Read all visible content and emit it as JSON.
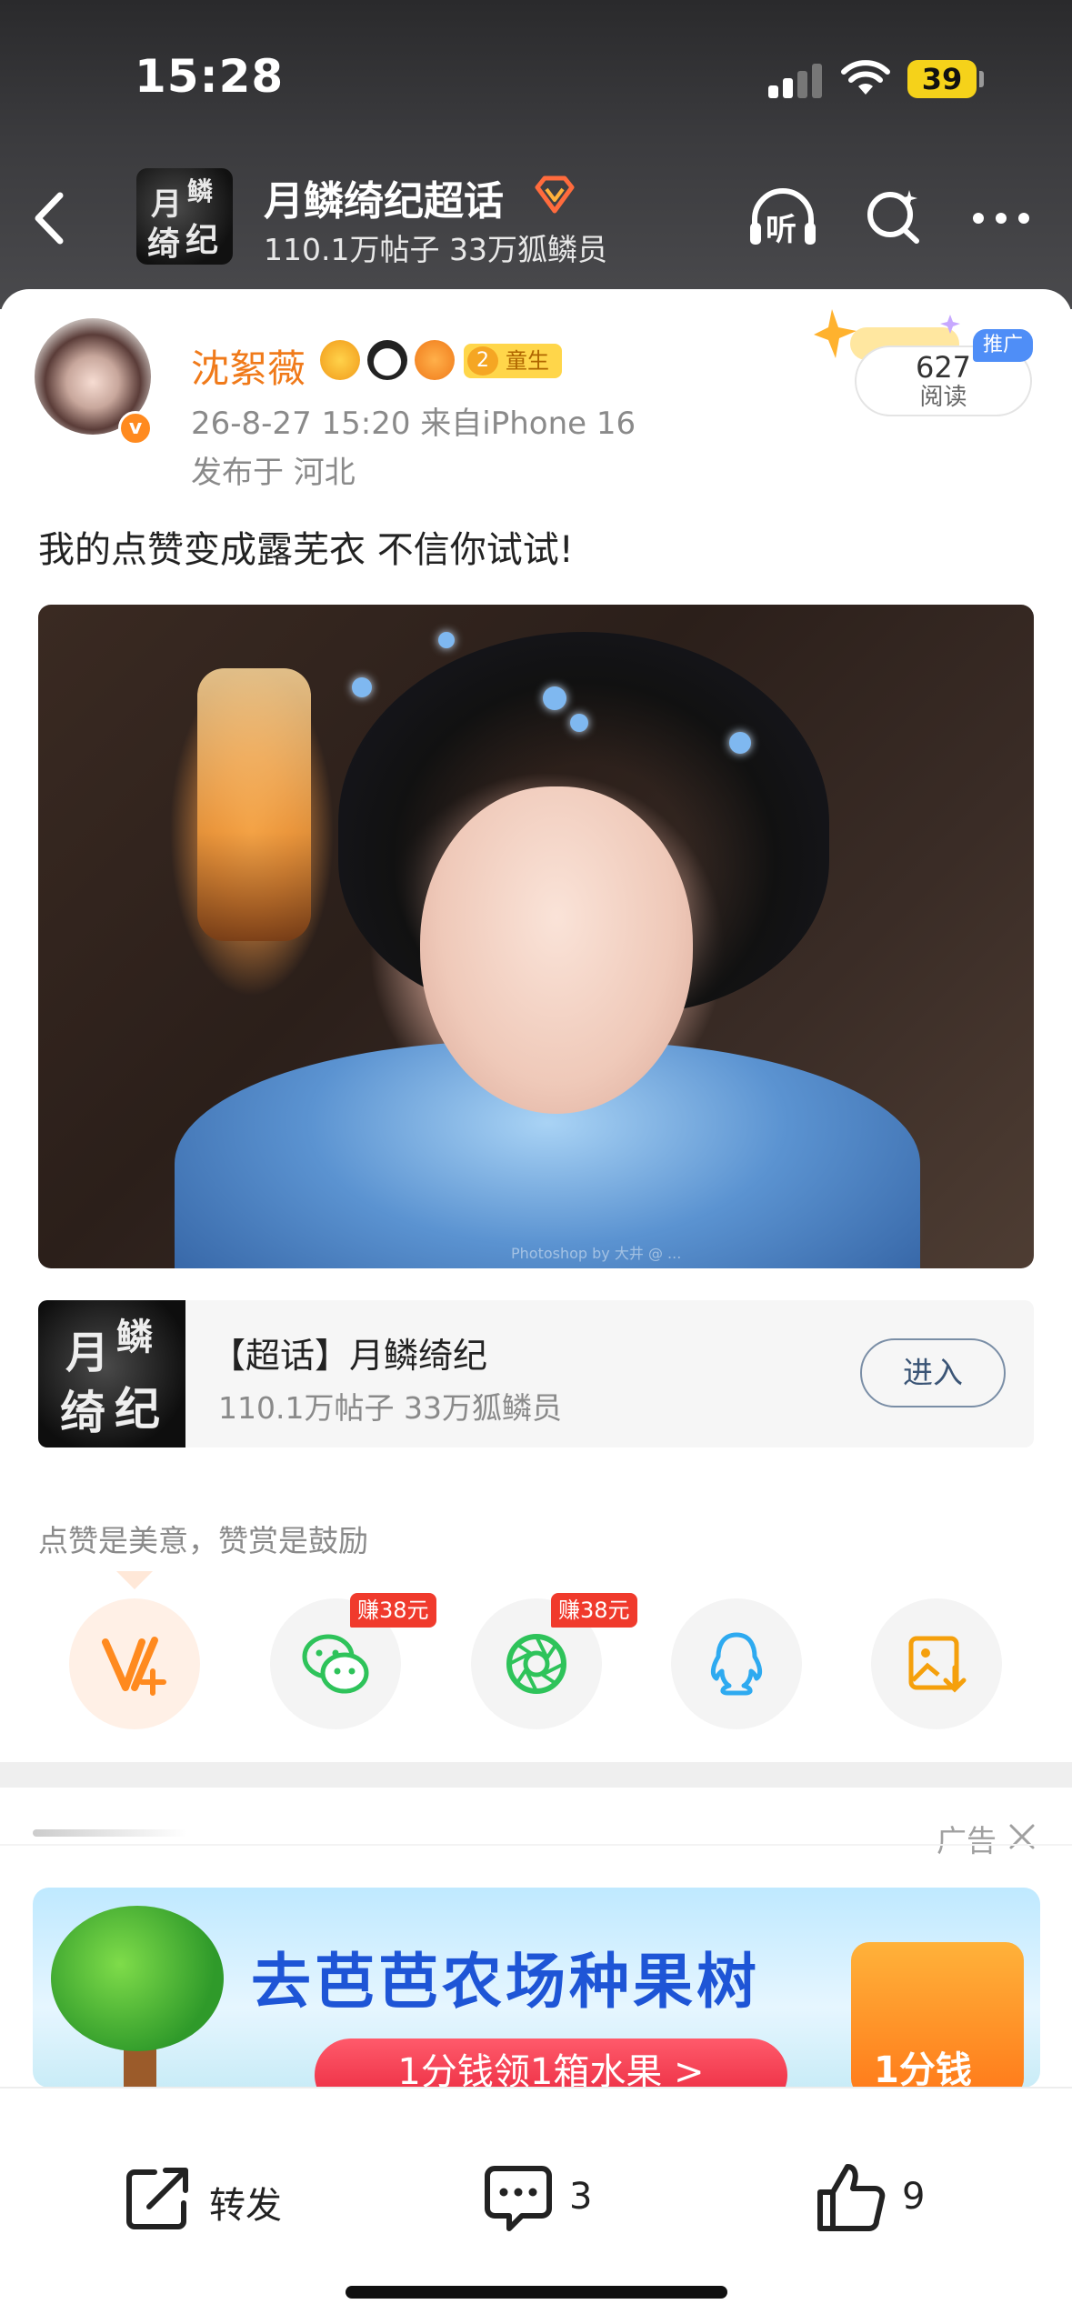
{
  "status_bar": {
    "time": "15:28",
    "battery": "39",
    "icons": [
      "signal-icon",
      "wifi-icon",
      "battery-icon"
    ]
  },
  "header": {
    "topic_title": "月鳞绮纪超话",
    "topic_stats": "110.1万帖子 33万狐鳞员",
    "thumb_text_1": "月",
    "thumb_text_2": "鳞",
    "thumb_text_3": "绮",
    "thumb_text_4": "纪",
    "listen_label": "听",
    "icons": [
      "back-icon",
      "gem-icon",
      "listen-icon",
      "search-icon",
      "more-icon"
    ]
  },
  "post": {
    "author": "沈絮薇",
    "level": "2",
    "level_label": "童生",
    "meta": "26-8-27 15:20  来自iPhone 16",
    "location": "发布于 河北",
    "read_count": "627",
    "read_label": "阅读",
    "promo_tag": "推广",
    "verified_mark": "v",
    "text": "我的点赞变成露芜衣  不信你试试!",
    "photo_watermark": "Photoshop by 大井 @ ..."
  },
  "topic_card": {
    "title": "【超话】月鳞绮纪",
    "stats": "110.1万帖子 33万狐鳞员",
    "enter_label": "进入"
  },
  "share": {
    "encourage_text": "点赞是美意，赞赏是鼓励",
    "wechat_earn": "赚38元",
    "moments_earn": "赚38元",
    "colors": {
      "vplus": "#ff8a1f",
      "wechat": "#2ec35a",
      "qq": "#2eaaf0",
      "save": "#f5a00c"
    }
  },
  "ad": {
    "label": "广告",
    "title": "去芭芭农场种果树",
    "cta": "1分钱领1箱水果 >",
    "side_text": "1分钱"
  },
  "bottom_bar": {
    "repost_label": "转发",
    "comment_count": "3",
    "like_count": "9"
  }
}
